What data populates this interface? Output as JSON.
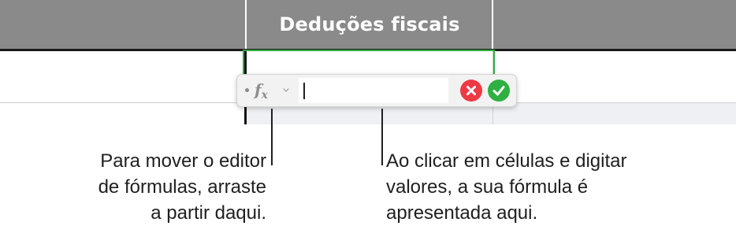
{
  "sheet": {
    "column_header_title": "Deduções fiscais"
  },
  "formula_editor": {
    "function_icon_label": "f",
    "function_icon_sub": "x",
    "function_icon": "fx-icon",
    "chevron_icon": "chevron-down-icon",
    "drag_handle_icon": "drag-handle-icon",
    "input_value": "",
    "cancel_icon": "cancel-x-icon",
    "accept_icon": "checkmark-icon",
    "colors": {
      "cancel": "#ee3a45",
      "accept": "#2fb042",
      "selection": "#2eac3e",
      "header": "#8a8a8a"
    }
  },
  "callouts": {
    "move_editor": [
      "Para mover o editor",
      "de fórmulas, arraste",
      "a partir daqui."
    ],
    "formula_display": [
      "Ao clicar em células e digitar",
      "valores, a sua fórmula é",
      "apresentada aqui."
    ]
  }
}
